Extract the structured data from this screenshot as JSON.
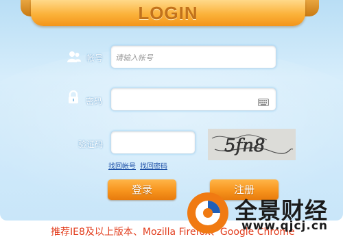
{
  "header": {
    "title": "LOGIN"
  },
  "form": {
    "account": {
      "label": "帐号",
      "placeholder": "请输入帐号",
      "icon": "users-icon"
    },
    "password": {
      "label": "密码",
      "placeholder": "",
      "icon": "lock-icon",
      "keyboard_icon": "keyboard-icon"
    },
    "captcha": {
      "label": "验证码",
      "placeholder": "",
      "image_text": "5fn8"
    },
    "links": {
      "find_account": "找回帐号",
      "find_password": "找回密码"
    },
    "buttons": {
      "login": "登录",
      "register": "注册"
    }
  },
  "footer": {
    "note": "推荐IE8及以上版本、Mozilla Firefox、Google Chrome"
  },
  "watermark": {
    "brand": "全景财经",
    "url": "www.qjcj.cn"
  },
  "colors": {
    "accent": "#f7941d",
    "panel": "#c9e6f9",
    "link": "#1c4fa6",
    "note": "#e23c1c"
  }
}
